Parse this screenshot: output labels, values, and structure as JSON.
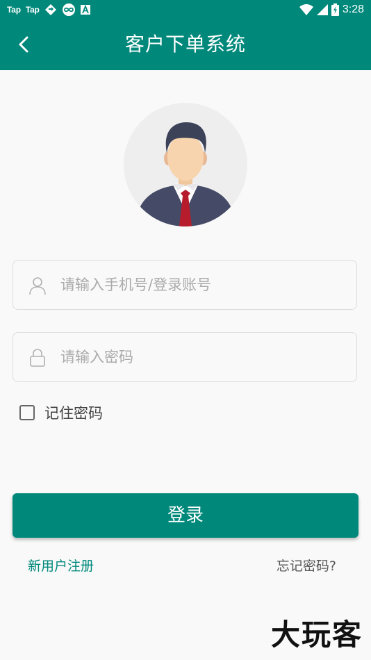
{
  "status_bar": {
    "app_icons": [
      "Tap",
      "Tap"
    ],
    "time": "3:28",
    "icons": [
      "sync-icon",
      "link-icon",
      "a-icon",
      "wifi-icon",
      "signal-icon",
      "battery-icon"
    ]
  },
  "app_bar": {
    "title": "客户下单系统",
    "back_icon": "chevron-left-icon"
  },
  "form": {
    "username_placeholder": "请输入手机号/登录账号",
    "password_placeholder": "请输入密码",
    "remember_label": "记住密码",
    "login_label": "登录"
  },
  "links": {
    "register": "新用户注册",
    "forgot": "忘记密码?"
  },
  "watermark": "大玩客",
  "colors": {
    "accent": "#00897b",
    "background": "#f9f9f9",
    "border": "#dddddd",
    "placeholder": "#aaaaaa"
  }
}
